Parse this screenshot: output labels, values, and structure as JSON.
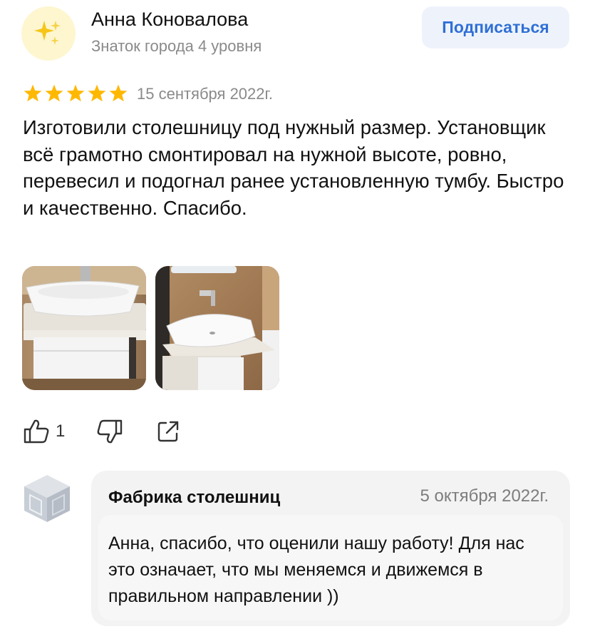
{
  "author": {
    "name": "Анна Коновалова",
    "level": "Знаток города 4 уровня",
    "avatar_icon": "sparkles-icon"
  },
  "subscribe_label": "Подписаться",
  "review": {
    "rating": 5,
    "rating_max": 5,
    "date": "15 сентября 2022г.",
    "text": "Изготовили столешницу под нужный размер. Установщик всё грамотно смонтировал на нужной высоте, ровно, перевесил и подогнал ранее установленную тумбу. Быстро и качественно. Спасибо.",
    "photos": [
      "bathroom-sink-photo-1",
      "bathroom-sink-photo-2"
    ]
  },
  "actions": {
    "like_icon": "thumbs-up-icon",
    "like_count": "1",
    "dislike_icon": "thumbs-down-icon",
    "share_icon": "share-icon"
  },
  "reply": {
    "company_name": "Фабрика столешниц",
    "date": "5 октября 2022г.",
    "text": "Анна, спасибо, что оценили нашу работу! Для нас это означает, что мы меняемся и движемся в правильном направлении ))",
    "avatar_icon": "company-cube-icon"
  },
  "colors": {
    "star": "#ffb800",
    "accent": "#2f6fd6",
    "subscribe_bg": "#eef3fb",
    "muted_text": "#8a8a8a",
    "reply_bg": "#f3f3f3"
  }
}
